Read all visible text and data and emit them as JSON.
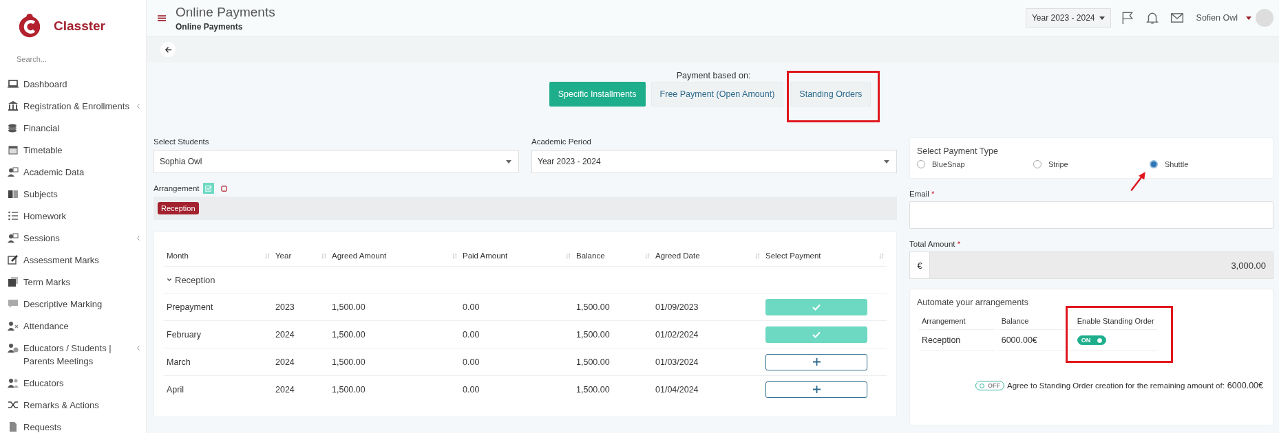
{
  "sidebar": {
    "brand": "Classter",
    "search": {
      "placeholder": "Search..."
    },
    "items": [
      {
        "label": "Dashboard",
        "has_submenu": false
      },
      {
        "label": "Registration & Enrollments",
        "has_submenu": true
      },
      {
        "label": "Financial",
        "has_submenu": false
      },
      {
        "label": "Timetable",
        "has_submenu": false
      },
      {
        "label": "Academic Data",
        "has_submenu": false
      },
      {
        "label": "Subjects",
        "has_submenu": false
      },
      {
        "label": "Homework",
        "has_submenu": false
      },
      {
        "label": "Sessions",
        "has_submenu": true
      },
      {
        "label": "Assessment Marks",
        "has_submenu": false
      },
      {
        "label": "Term Marks",
        "has_submenu": false
      },
      {
        "label": "Descriptive Marking",
        "has_submenu": false
      },
      {
        "label": "Attendance",
        "has_submenu": false
      },
      {
        "label": "Educators / Students | Parents Meetings",
        "has_submenu": true
      },
      {
        "label": "Educators",
        "has_submenu": false
      },
      {
        "label": "Remarks & Actions",
        "has_submenu": false
      },
      {
        "label": "Requests",
        "has_submenu": false
      }
    ]
  },
  "header": {
    "title": "Online Payments",
    "breadcrumb": "Online Payments",
    "year_select": "Year 2023 - 2024",
    "user": "Sofien Owl"
  },
  "payment_basis": {
    "label": "Payment based on:",
    "tabs": [
      {
        "label": "Specific Installments",
        "selected": true,
        "highlighted": false
      },
      {
        "label": "Free Payment (Open Amount)",
        "selected": false,
        "highlighted": false
      },
      {
        "label": "Standing Orders",
        "selected": false,
        "highlighted": true
      }
    ]
  },
  "students": {
    "label": "Select Students",
    "value": "Sophia Owl"
  },
  "academic_period": {
    "label": "Academic Period",
    "value": "Year 2023 - 2024"
  },
  "arrangement": {
    "label": "Arrangement",
    "tags": [
      "Reception"
    ]
  },
  "table": {
    "columns": [
      "Month",
      "Year",
      "Agreed Amount",
      "Paid Amount",
      "Balance",
      "Agreed Date",
      "Select Payment"
    ],
    "groups": [
      {
        "name": "Reception",
        "expanded": true,
        "rows": [
          {
            "cells": [
              "Prepayment",
              "2023",
              "1,500.00",
              "0.00",
              "1,500.00",
              "01/09/2023"
            ],
            "selected": true
          },
          {
            "cells": [
              "February",
              "2024",
              "1,500.00",
              "0.00",
              "1,500.00",
              "01/02/2024"
            ],
            "selected": true
          },
          {
            "cells": [
              "March",
              "2024",
              "1,500.00",
              "0.00",
              "1,500.00",
              "01/03/2024"
            ],
            "selected": false
          },
          {
            "cells": [
              "April",
              "2024",
              "1,500.00",
              "0.00",
              "1,500.00",
              "01/04/2024"
            ],
            "selected": false
          }
        ]
      }
    ]
  },
  "payment_type": {
    "title": "Select Payment Type",
    "options": [
      {
        "label": "BlueSnap",
        "selected": false,
        "pointed": false
      },
      {
        "label": "Stripe",
        "selected": false,
        "pointed": false
      },
      {
        "label": "Shuttle",
        "selected": true,
        "pointed": true
      }
    ]
  },
  "email": {
    "label": "Email",
    "required_mark": "*"
  },
  "total_amount": {
    "label": "Total Amount",
    "required_mark": "*",
    "currency": "€",
    "value": "3,000.00"
  },
  "automate": {
    "title": "Automate your arrangements",
    "columns": [
      {
        "label": "Arrangement",
        "highlighted": false
      },
      {
        "label": "Balance",
        "highlighted": false
      },
      {
        "label": "Enable Standing Order",
        "highlighted": true
      }
    ],
    "rows": [
      {
        "arrangement": "Reception",
        "balance": "6000.00€",
        "toggle": {
          "on": true,
          "label": "ON"
        }
      }
    ],
    "agreement": {
      "toggle": {
        "on": false,
        "label": "OFF"
      },
      "text": "Agree to Standing Order creation for the remaining amount of:",
      "amount": "6000.00€"
    }
  }
}
